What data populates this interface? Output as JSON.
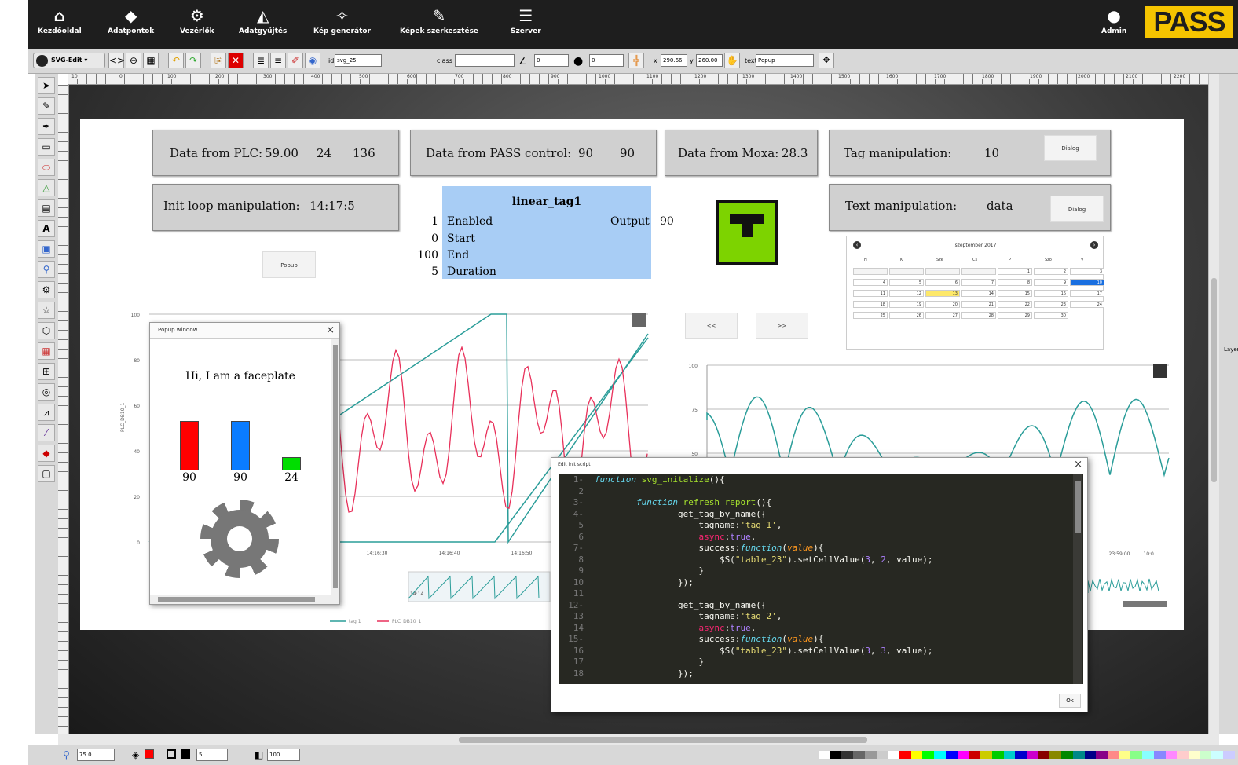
{
  "nav": {
    "home": "Kezdőoldal",
    "datapoints": "Adatpontok",
    "controllers": "Vezérlők",
    "datacollect": "Adatgyűjtés",
    "imagegen": "Kép generátor",
    "imageedit": "Képek szerkesztése",
    "server": "Szerver",
    "admin": "Admin",
    "logo": "PASS"
  },
  "toolbar": {
    "menu_label": "SVG-Edit ▾",
    "id_label": "id",
    "id_value": "svg_25",
    "class_label": "class",
    "class_value": "",
    "angle_value": "0",
    "blur_value": "0",
    "x_label": "x",
    "x_value": "290.66",
    "y_label": "y",
    "y_value": "260.00",
    "text_label": "text",
    "text_value": "Popup"
  },
  "ruler_h": [
    "10",
    "0",
    "100",
    "200",
    "300",
    "400",
    "500",
    "600",
    "700",
    "800",
    "900",
    "1000",
    "1100",
    "1200",
    "1300",
    "1400",
    "1500",
    "1600",
    "1700",
    "1800",
    "1900",
    "2000",
    "2100",
    "2200"
  ],
  "boxes": {
    "plc": {
      "label": "Data from PLC:",
      "v1": "59.00",
      "v2": "24",
      "v3": "136"
    },
    "pass": {
      "label": "Data from PASS control:",
      "v1": "90",
      "v2": "90"
    },
    "moxa": {
      "label": "Data from Moxa:",
      "v1": "28.3"
    },
    "tag": {
      "label": "Tag manipulation:",
      "v1": "10",
      "btn": "Dialog"
    },
    "init": {
      "label": "Init loop manipulation:",
      "v1": "14:17:5"
    },
    "text": {
      "label": "Text manipulation:",
      "v1": "data",
      "btn": "Dialog"
    }
  },
  "popup_btn": "Popup",
  "linear_tag": {
    "title": "linear_tag1",
    "rows": [
      {
        "v": "1",
        "label": "Enabled"
      },
      {
        "v": "0",
        "label": "Start"
      },
      {
        "v": "100",
        "label": "End"
      },
      {
        "v": "5",
        "label": "Duration"
      }
    ],
    "output_label": "Output",
    "output_value": "90"
  },
  "nav_buttons": {
    "prev": "<<",
    "next": ">>"
  },
  "calendar": {
    "title": "szeptember 2017",
    "weekdays": [
      "H",
      "K",
      "Sze",
      "Cs",
      "P",
      "Szo",
      "V"
    ],
    "weeks": [
      [
        "",
        "",
        "",
        "",
        "1",
        "2",
        "3"
      ],
      [
        "4",
        "5",
        "6",
        "7",
        "8",
        "9",
        "10"
      ],
      [
        "11",
        "12",
        "13",
        "14",
        "15",
        "16",
        "17"
      ],
      [
        "18",
        "19",
        "20",
        "21",
        "22",
        "23",
        "24"
      ],
      [
        "25",
        "26",
        "27",
        "28",
        "29",
        "30",
        ""
      ]
    ],
    "today": "13",
    "selected": "10"
  },
  "chart_left": {
    "yticks": [
      "100",
      "80",
      "60",
      "40",
      "20",
      "0"
    ],
    "xticks": [
      "14:16:30",
      "14:16:40",
      "14:16:50"
    ],
    "ylabel": "PLC_DB10_1",
    "legend": [
      "tag 1",
      "PLC_DB10_1"
    ],
    "mini_label": "14:14"
  },
  "chart_right": {
    "yticks": [
      "100",
      "75",
      "50"
    ],
    "xticks": [
      "23:59:00",
      "10:0..."
    ]
  },
  "faceplate": {
    "title": "Popup window",
    "close": "×",
    "greeting": "Hi, I am a faceplate",
    "bars": [
      {
        "value": "90",
        "color": "#ff0000",
        "level": 0.9
      },
      {
        "value": "90",
        "color": "#0a7cff",
        "level": 0.9
      },
      {
        "value": "24",
        "color": "#00dd00",
        "level": 0.24
      }
    ]
  },
  "code_window": {
    "title": "Edit init script",
    "close": "×",
    "ok": "Ok",
    "line_numbers": [
      "1-",
      "2",
      "3-",
      "4-",
      "5",
      "6",
      "7-",
      "8",
      "9",
      "10",
      "11",
      "12-",
      "13",
      "14",
      "15-",
      "16",
      "17",
      "18"
    ]
  },
  "bottom": {
    "zoom": "75.0",
    "stroke_width": "5",
    "opacity": "100"
  },
  "layers_label": "Layers"
}
